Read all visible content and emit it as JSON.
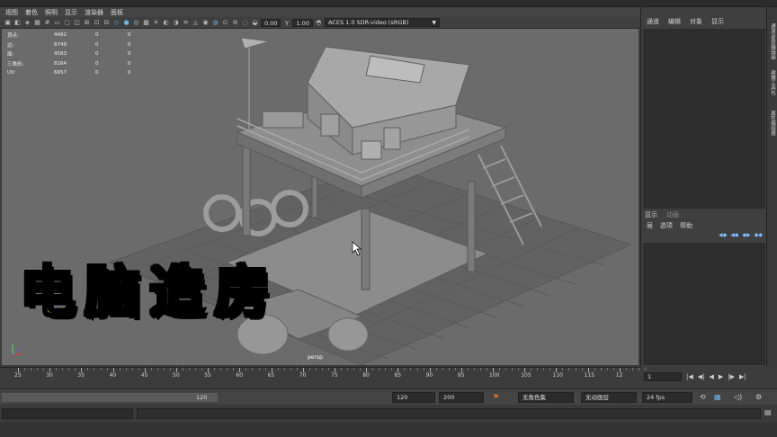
{
  "menu": [
    "视图",
    "着色",
    "照明",
    "显示",
    "渲染器",
    "面板"
  ],
  "toolbar": {
    "exposure": "0.00",
    "gamma": "1.00",
    "color_space": "ACES 1.0 SDR-video (sRGB)"
  },
  "hud": {
    "rows": [
      {
        "label": "顶点:",
        "a": "4462",
        "b": "0",
        "c": "0"
      },
      {
        "label": "边:",
        "a": "8749",
        "b": "0",
        "c": "0"
      },
      {
        "label": "面:",
        "a": "4583",
        "b": "0",
        "c": "0"
      },
      {
        "label": "三角形:",
        "a": "8164",
        "b": "0",
        "c": "0"
      },
      {
        "label": "UV:",
        "a": "6657",
        "b": "0",
        "c": "0"
      }
    ]
  },
  "viewport": {
    "camera_label": "persp",
    "overlay_title": "电脑造房"
  },
  "right_panel": {
    "tabs": [
      "通道",
      "编辑",
      "对象",
      "显示"
    ],
    "layer_tabs": [
      "显示",
      "动画"
    ],
    "layer_menu": [
      "层",
      "选项",
      "帮助"
    ]
  },
  "side_tabs": [
    "通道盒/层编辑器",
    "建模工具包",
    "属性编辑器"
  ],
  "timeline": {
    "ticks": [
      "25",
      "30",
      "35",
      "40",
      "45",
      "50",
      "55",
      "60",
      "65",
      "70",
      "75",
      "80",
      "85",
      "90",
      "95",
      "100",
      "105",
      "110",
      "115",
      "12"
    ],
    "current_frame": "1"
  },
  "range": {
    "range_end": "120",
    "anim_end": "120",
    "playback_end": "200",
    "character_set": "无角色集",
    "anim_layer": "无动画层",
    "fps": "24 fps"
  },
  "colors": {
    "title_yellow": "#ffe400",
    "viewport_bg": "#6b6b6b",
    "accent_blue": "#6fb4e8"
  }
}
